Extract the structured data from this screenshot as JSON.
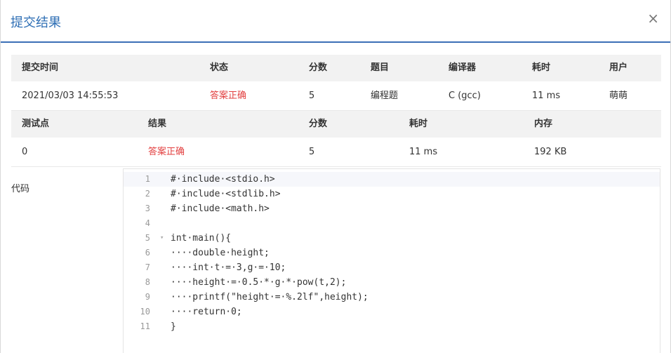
{
  "dialog": {
    "title": "提交结果",
    "close_glyph": "×"
  },
  "submission": {
    "headers": [
      "提交时间",
      "状态",
      "分数",
      "题目",
      "编译器",
      "耗时",
      "用户"
    ],
    "row": [
      "2021/03/03 14:55:53",
      "答案正确",
      "5",
      "编程题",
      "C (gcc)",
      "11 ms",
      "萌萌"
    ]
  },
  "testpoints": {
    "headers": [
      "测试点",
      "结果",
      "分数",
      "耗时",
      "内存"
    ],
    "row": [
      "0",
      "答案正确",
      "5",
      "11 ms",
      "192 KB"
    ]
  },
  "code": {
    "label": "代码",
    "line_numbers": [
      "1",
      "2",
      "3",
      "4",
      "5",
      "6",
      "7",
      "8",
      "9",
      "10",
      "11"
    ],
    "lines": [
      "#·include·<stdio.h>",
      "#·include·<stdlib.h>",
      "#·include·<math.h>",
      "",
      "int·main(){",
      "····double·height;",
      "····int·t·=·3,g·=·10;",
      "····height·=·0.5·*·g·*·pow(t,2);",
      "····printf(\"height·=·%.2lf\",height);",
      "····return·0;",
      "}"
    ],
    "fold_glyph": "▾"
  },
  "colors": {
    "accent": "#2f6fb5",
    "accepted": "#e23f3f",
    "header_bg": "#f2f2f2"
  }
}
